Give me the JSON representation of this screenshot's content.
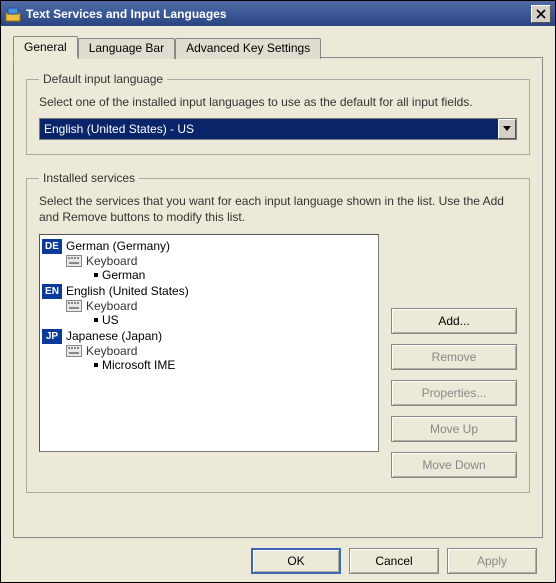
{
  "window": {
    "title": "Text Services and Input Languages"
  },
  "tabs": {
    "general": "General",
    "langbar": "Language Bar",
    "advanced": "Advanced Key Settings"
  },
  "default_group": {
    "legend": "Default input language",
    "desc": "Select one of the installed input languages to use as the default for all input fields.",
    "selected": "English (United States) - US"
  },
  "services_group": {
    "legend": "Installed services",
    "desc": "Select the services that you want for each input language shown in the list. Use the Add and Remove buttons to modify this list.",
    "langs": [
      {
        "badge": "DE",
        "name": "German (Germany)",
        "cat": "Keyboard",
        "layout": "German"
      },
      {
        "badge": "EN",
        "name": "English (United States)",
        "cat": "Keyboard",
        "layout": "US"
      },
      {
        "badge": "JP",
        "name": "Japanese (Japan)",
        "cat": "Keyboard",
        "layout": "Microsoft IME"
      }
    ],
    "buttons": {
      "add": "Add...",
      "remove": "Remove",
      "properties": "Properties...",
      "moveup": "Move Up",
      "movedown": "Move Down"
    }
  },
  "footer": {
    "ok": "OK",
    "cancel": "Cancel",
    "apply": "Apply"
  }
}
